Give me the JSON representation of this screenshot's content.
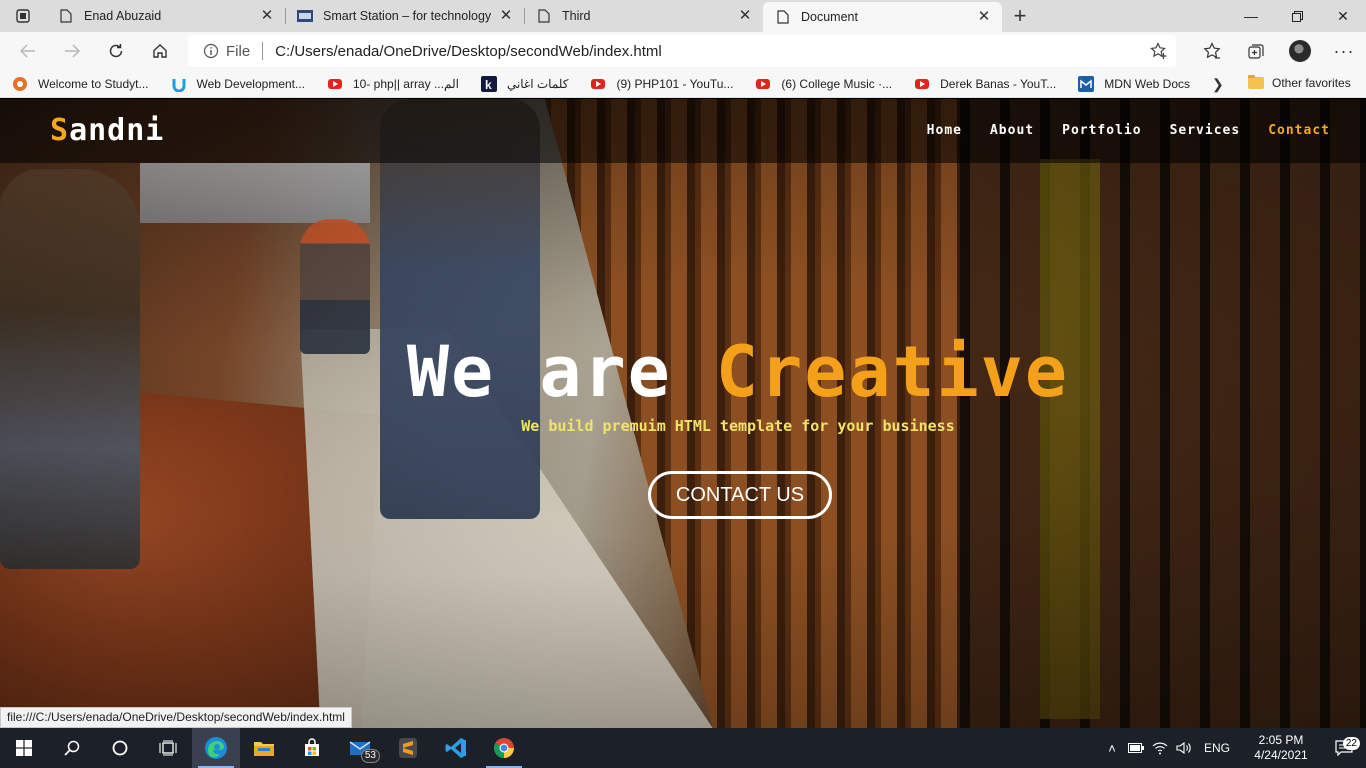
{
  "browser": {
    "tabs": [
      {
        "title": "Enad Abuzaid",
        "icon": "document-icon",
        "active": false
      },
      {
        "title": "Smart Station – for technology",
        "icon": "site-favicon-icon",
        "active": false
      },
      {
        "title": "Third",
        "icon": "document-icon",
        "active": false
      },
      {
        "title": "Document",
        "icon": "document-icon",
        "active": true
      }
    ],
    "address": {
      "scheme_label": "File",
      "url": "C:/Users/enada/OneDrive/Desktop/secondWeb/index.html"
    },
    "favorites": [
      {
        "label": "Welcome to Studyt...",
        "icon": "studytonight-icon"
      },
      {
        "label": "Web Development...",
        "icon": "udemy-icon"
      },
      {
        "label": "10- php|| array ...الم",
        "icon": "youtube-icon"
      },
      {
        "label": "كلمات اغاني",
        "icon": "k-icon"
      },
      {
        "label": "(9) PHP101 - YouTu...",
        "icon": "youtube-icon"
      },
      {
        "label": "(6) College Music ·...",
        "icon": "youtube-icon"
      },
      {
        "label": "Derek Banas - YouT...",
        "icon": "youtube-icon"
      },
      {
        "label": "MDN Web Docs",
        "icon": "mdn-icon"
      }
    ],
    "other_favorites": "Other favorites",
    "status_url": "file:///C:/Users/enada/OneDrive/Desktop/secondWeb/index.html"
  },
  "site": {
    "logo_first": "S",
    "logo_rest": "andni",
    "nav": [
      {
        "label": "Home",
        "active": false
      },
      {
        "label": "About",
        "active": false
      },
      {
        "label": "Portfolio",
        "active": false
      },
      {
        "label": "Services",
        "active": false
      },
      {
        "label": "Contact",
        "active": true
      }
    ],
    "hero_title_plain": "We are ",
    "hero_title_accent": "Creative",
    "hero_subtitle": "We build premuim HTML template for your business",
    "cta_label": "CONTACT US",
    "accent_color": "#f5a01a"
  },
  "taskbar": {
    "mail_badge": "53",
    "language": "ENG",
    "time": "2:05 PM",
    "date": "4/24/2021",
    "notification_count": "22"
  }
}
